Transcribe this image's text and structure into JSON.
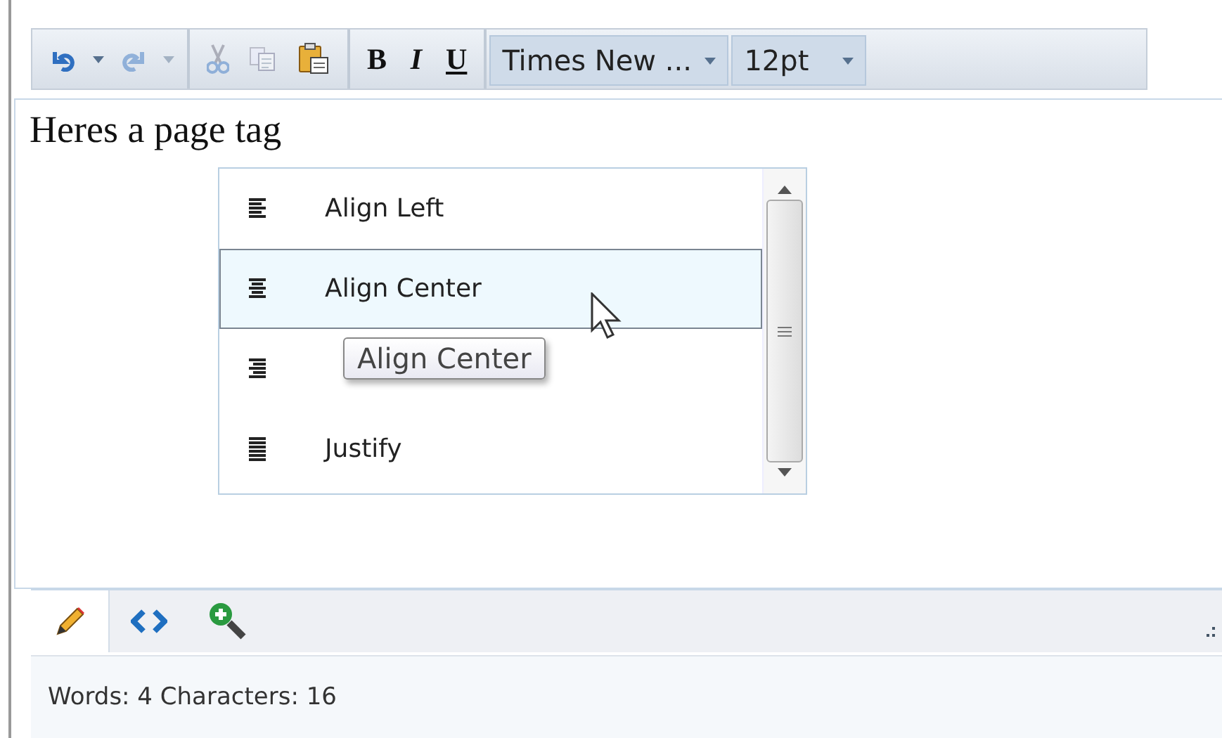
{
  "toolbar": {
    "groups": [
      {
        "buttons": [
          {
            "kind": "undo",
            "disabled": false
          },
          {
            "kind": "caret",
            "disabled": false
          },
          {
            "kind": "redo",
            "disabled": true
          },
          {
            "kind": "caret",
            "disabled": true
          }
        ]
      },
      {
        "buttons": [
          {
            "kind": "cut",
            "disabled": true
          },
          {
            "kind": "copy",
            "disabled": true
          },
          {
            "kind": "paste",
            "disabled": false
          }
        ]
      },
      {
        "buttons": [
          {
            "kind": "bold",
            "label": "B",
            "disabled": false
          },
          {
            "kind": "italic",
            "label": "I",
            "disabled": false
          },
          {
            "kind": "underline",
            "label": "U",
            "disabled": false
          }
        ]
      }
    ],
    "font": {
      "value": "Times New ..."
    },
    "size": {
      "value": "12pt"
    }
  },
  "editor": {
    "text": "Heres a page tag"
  },
  "align_menu": {
    "items": [
      {
        "kind": "left",
        "label": "Align Left",
        "selected": false
      },
      {
        "kind": "center",
        "label": "Align Center",
        "selected": true
      },
      {
        "kind": "right",
        "selected": false
      },
      {
        "kind": "justify",
        "label": "Justify",
        "selected": false
      }
    ],
    "tooltip": "Align Center"
  },
  "mode_tabs": [
    {
      "kind": "design",
      "selected": true
    },
    {
      "kind": "html",
      "selected": false
    },
    {
      "kind": "preview",
      "selected": false
    }
  ],
  "status_bar": {
    "text": "Words: 4 Characters: 16"
  }
}
